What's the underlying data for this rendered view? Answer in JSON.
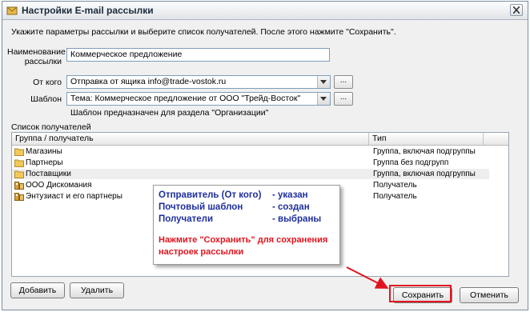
{
  "window": {
    "title": "Настройки E-mail рассылки"
  },
  "instruction": "Укажите параметры рассылки и выберите список получателей. После этого нажмите \"Сохранить\".",
  "form": {
    "name_label_1": "Наименование",
    "name_label_2": "рассылки",
    "name_value": "Коммерческое предложение",
    "from_label": "От кого",
    "from_value": "Отправка от ящика info@trade-vostok.ru",
    "template_label": "Шаблон",
    "template_value": "Тема: Коммерческое предложение от ООО \"Трейд-Восток\"",
    "browse_label": "...",
    "template_hint": "Шаблон предназначен для раздела \"Организации\""
  },
  "recipients": {
    "section_label": "Список получателей",
    "columns": [
      "Группа / получатель",
      "Тип"
    ],
    "rows": [
      {
        "name": "Магазины",
        "type": "Группа, включая подгруппы",
        "icon": "folder-icon"
      },
      {
        "name": "Партнеры",
        "type": "Группа без подгрупп",
        "icon": "folder-icon"
      },
      {
        "name": "Поставщики",
        "type": "Группа, включая подгруппы",
        "icon": "folder-icon"
      },
      {
        "name": "ООО Дискомания",
        "type": "Получатель",
        "icon": "recipient-icon"
      },
      {
        "name": "Энтузиаст и его партнеры",
        "type": "Получатель",
        "icon": "recipient-icon"
      }
    ]
  },
  "callout": {
    "line1_a": "Отправитель (От кого)",
    "line1_b": "- указан",
    "line2_a": "Почтовый шаблон",
    "line2_b": "- создан",
    "line3_a": "Получатели",
    "line3_b": "- выбраны",
    "note_1": "Нажмите \"Сохранить\" для сохранения",
    "note_2": "настроек рассылки"
  },
  "buttons": {
    "add": "Добавить",
    "remove": "Удалить",
    "save": "Сохранить",
    "cancel": "Отменить"
  },
  "colors": {
    "callout_text": "#1f2f9c",
    "highlight_red": "#e0141e"
  }
}
